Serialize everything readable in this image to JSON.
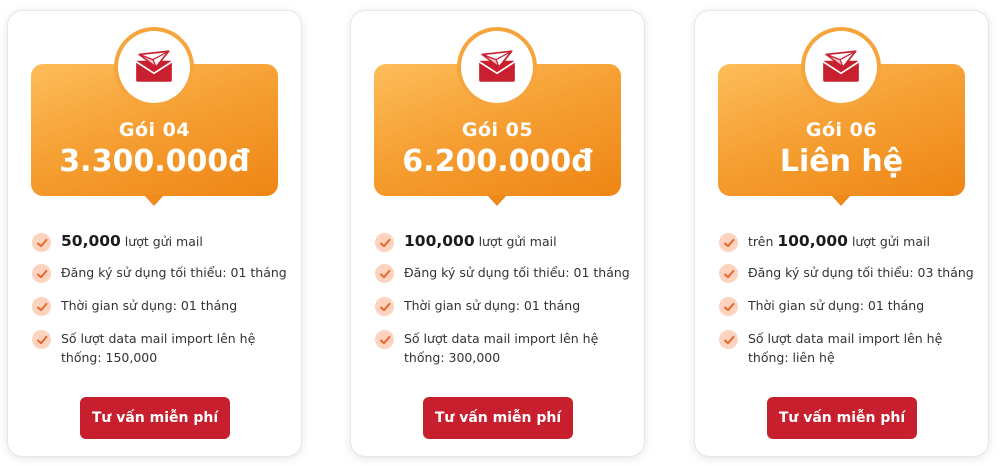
{
  "colors": {
    "accent_orange": "#f6a034",
    "button_red": "#c71f2d",
    "check_bg": "#fbd3bf",
    "check_mark": "#e8652b"
  },
  "icons": {
    "badge": "envelope-paper-plane-icon",
    "feature": "check-icon"
  },
  "plans": [
    {
      "name": "Gói 04",
      "price": "3.300.000đ",
      "features": [
        {
          "prefix": "",
          "highlight": "50,000",
          "suffix": " lượt gửi mail"
        },
        {
          "text": "Đăng ký sử dụng tối thiểu: 01 tháng"
        },
        {
          "text": "Thời gian sử dụng: 01 tháng"
        },
        {
          "text": "Số lượt data mail import lên hệ thống: 150,000"
        }
      ],
      "cta": "Tư vấn miễn phí"
    },
    {
      "name": "Gói 05",
      "price": "6.200.000đ",
      "features": [
        {
          "prefix": "",
          "highlight": "100,000",
          "suffix": " lượt gửi mail"
        },
        {
          "text": "Đăng ký sử dụng tối thiểu: 01 tháng"
        },
        {
          "text": "Thời gian sử dụng: 01 tháng"
        },
        {
          "text": "Số lượt data mail import lên hệ thống: 300,000"
        }
      ],
      "cta": "Tư vấn miễn phí"
    },
    {
      "name": "Gói 06",
      "price": "Liên hệ",
      "features": [
        {
          "prefix": "trên ",
          "highlight": "100,000",
          "suffix": " lượt gửi mail"
        },
        {
          "text": "Đăng ký sử dụng tối thiểu: 03 tháng"
        },
        {
          "text": "Thời gian sử dụng: 01 tháng"
        },
        {
          "text": "Số lượt data mail import lên hệ thống: liên hệ"
        }
      ],
      "cta": "Tư vấn miễn phí"
    }
  ]
}
